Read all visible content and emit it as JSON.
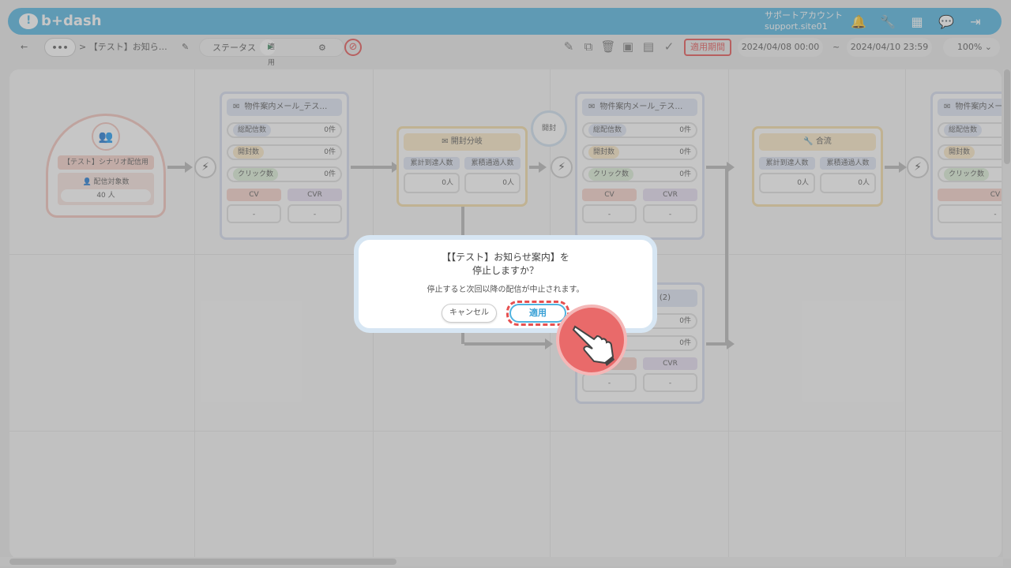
{
  "header": {
    "logo_text": "b+dash",
    "account_name": "サポートアカウント",
    "account_site": "support.site01",
    "icons": [
      "bell-icon",
      "wrench-icon",
      "grid-icon",
      "chat-icon",
      "logout-icon"
    ]
  },
  "toolbar": {
    "back": "←",
    "more": "•••",
    "breadcrumb": "> 【テスト】お知ら…",
    "status_label": "ステータス",
    "status_value": "適用中",
    "period_label": "適用期間",
    "date_start": "2024/04/08 00:00",
    "tilde": "~",
    "date_end": "2024/04/10 23:59",
    "zoom": "100%"
  },
  "canvas": {
    "start": {
      "title": "【テスト】シナリオ配信用",
      "sub_label": "配信対象数",
      "count": "40 人"
    },
    "mail1": {
      "title": "物件案内メール_テス…",
      "m1": "総配信数",
      "v1": "0件",
      "m2": "開封数",
      "v2": "0件",
      "m3": "クリック数",
      "v3": "0件",
      "cv": "CV",
      "cvr": "CVR",
      "cvv": "-",
      "cvrv": "-"
    },
    "branch": {
      "title": "開封分岐",
      "c1": "累計到達人数",
      "c2": "累積通過人数",
      "v1": "0人",
      "v2": "0人"
    },
    "open_label": "開封",
    "mail2": {
      "title": "物件案内メール_テス…",
      "m1": "総配信数",
      "v1": "0件",
      "m2": "開封数",
      "v2": "0件",
      "m3": "クリック数",
      "v3": "0件",
      "cv": "CV",
      "cvr": "CVR",
      "cvv": "-",
      "cvrv": "-"
    },
    "merge": {
      "title": "合流",
      "c1": "累計到達人数",
      "c2": "累積通過人数",
      "v1": "0人",
      "v2": "0人"
    },
    "mail3": {
      "title": "物件案内メール_テス…",
      "m1": "総配信数",
      "m2": "開封数",
      "m3": "クリック数",
      "cv": "CV",
      "cvv": "-"
    },
    "mail4": {
      "title_suffix": "(2)",
      "v1": "0件",
      "v2": "0件",
      "cvr": "CVR",
      "cvv": "-",
      "cvrv": "-"
    }
  },
  "dialog": {
    "title_line1": "【【テスト】お知らせ案内】を",
    "title_line2": "停止しますか？",
    "message": "停止すると次回以降の配信が中止されます。",
    "cancel": "キャンセル",
    "apply": "適用"
  },
  "colors": {
    "brand": "#4fb3e0",
    "alert": "#e65050"
  }
}
